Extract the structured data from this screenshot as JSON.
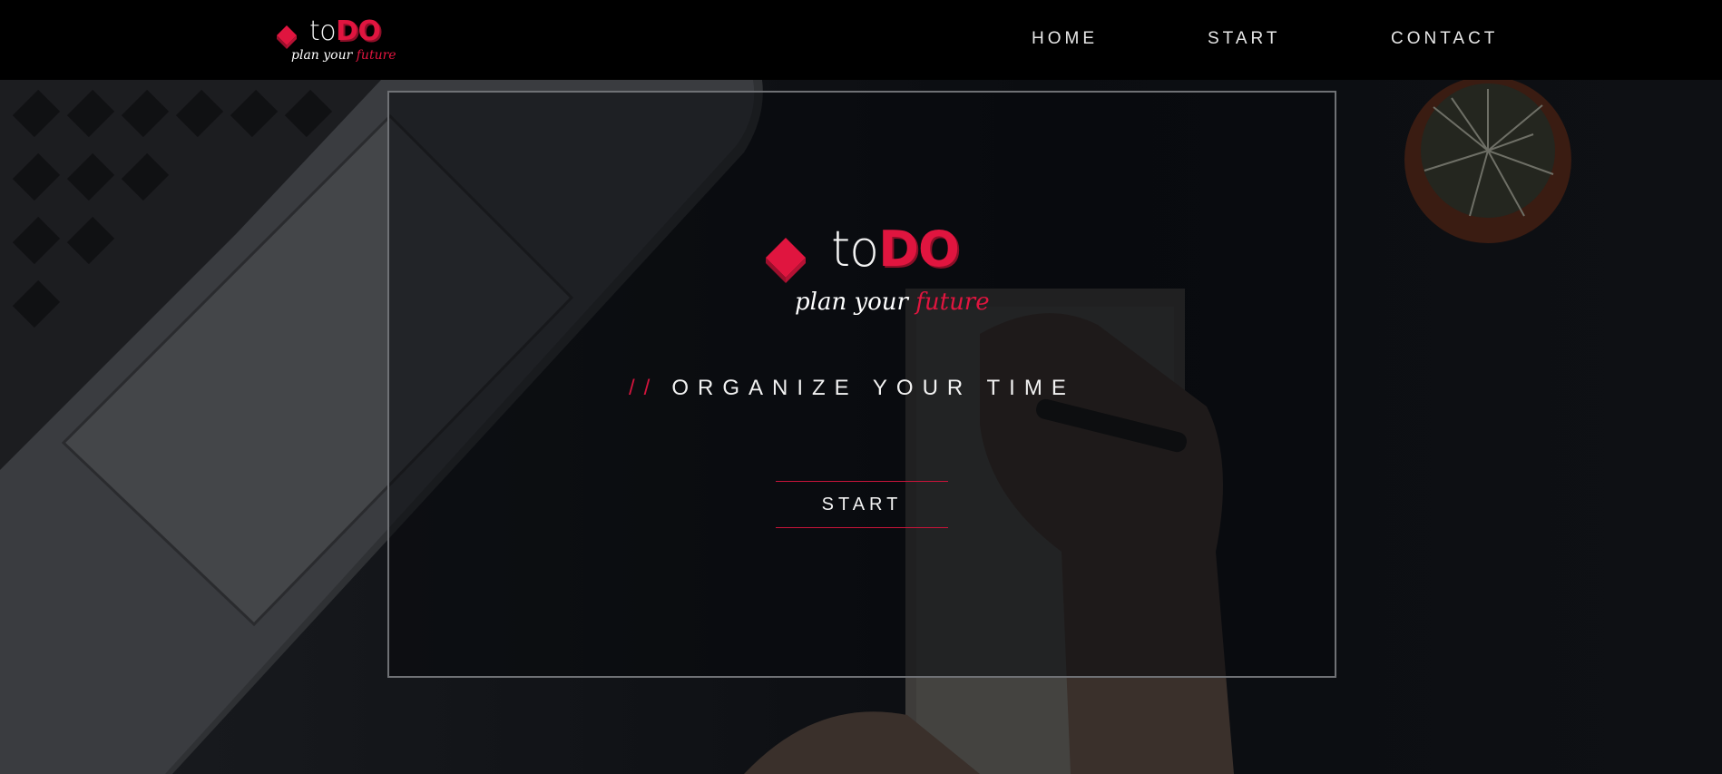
{
  "header": {
    "brand": {
      "word_light": "to",
      "word_bold": "DO",
      "tagline_plain": "plan your ",
      "tagline_accent": "future",
      "icon": "diamond-icon"
    },
    "nav": [
      {
        "label": "HOME"
      },
      {
        "label": "START"
      },
      {
        "label": "CONTACT"
      }
    ]
  },
  "hero": {
    "brand": {
      "word_light": "to",
      "word_bold": "DO",
      "tagline_plain": "plan your ",
      "tagline_accent": "future",
      "icon": "diamond-icon"
    },
    "slogan_prefix": "//",
    "slogan": "ORGANIZE YOUR TIME",
    "cta_label": "START"
  },
  "colors": {
    "accent": "#e0153f",
    "header_bg": "#000000",
    "panel_border": "#6f7175",
    "text": "#f2f2f2"
  }
}
